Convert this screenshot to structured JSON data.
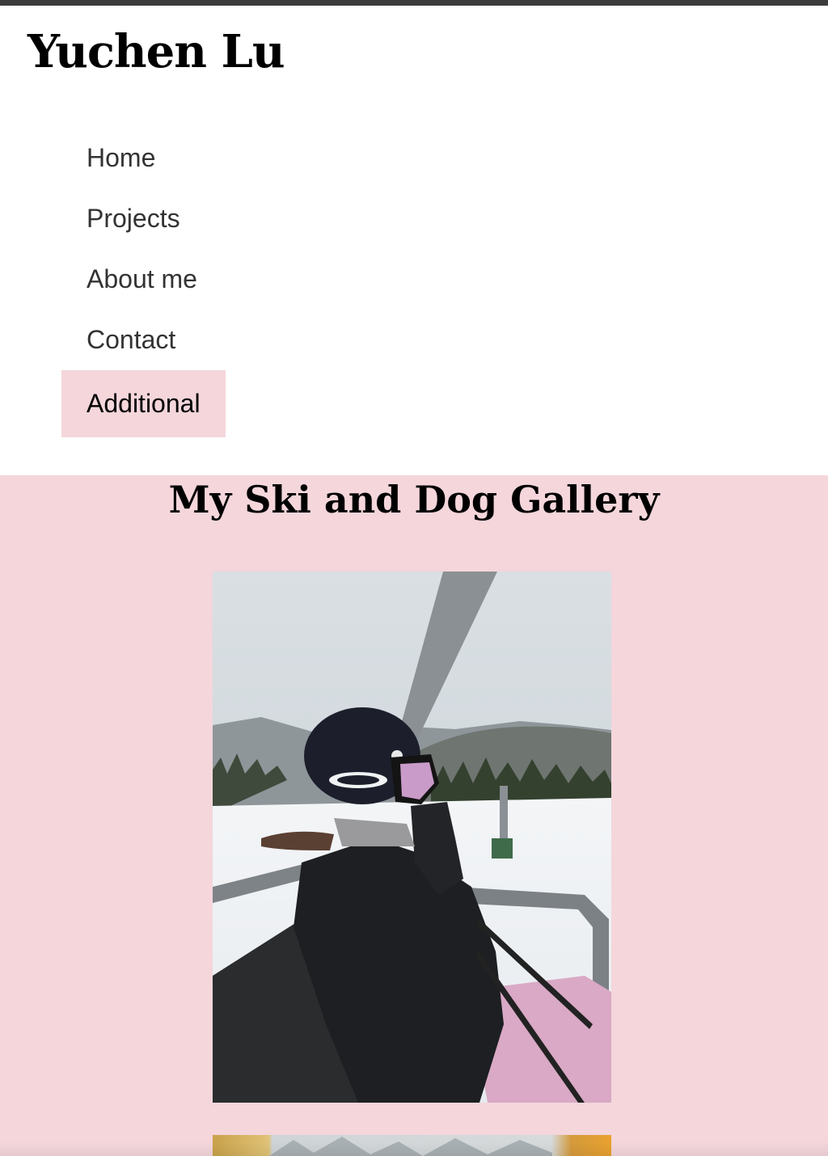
{
  "site": {
    "title": "Yuchen Lu"
  },
  "nav": {
    "items": [
      {
        "label": "Home",
        "active": false
      },
      {
        "label": "Projects",
        "active": false
      },
      {
        "label": "About me",
        "active": false
      },
      {
        "label": "Contact",
        "active": false
      },
      {
        "label": "Additional",
        "active": true
      }
    ]
  },
  "gallery": {
    "title": "My Ski and Dog Gallery",
    "photos": [
      {
        "subject": "skier-on-chairlift-photo"
      },
      {
        "subject": "mountain-landscape-photo"
      }
    ]
  },
  "colors": {
    "top_bar": "#3b3b3b",
    "accent_pink": "#f4d6db",
    "nav_text": "#333333",
    "title_text": "#000000"
  }
}
